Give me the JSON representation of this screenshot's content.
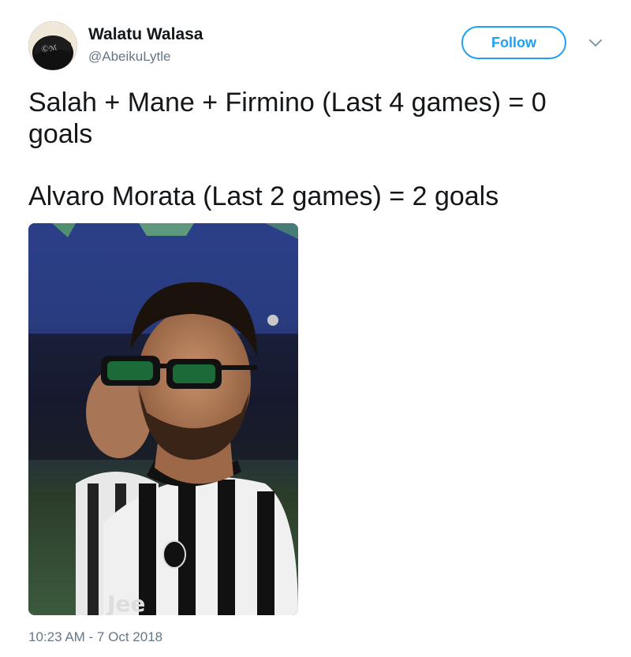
{
  "author": {
    "display_name": "Walatu Walasa",
    "handle": "@AbeikuLytle",
    "avatar_icon": "user-avatar"
  },
  "actions": {
    "follow_label": "Follow",
    "menu_icon": "chevron-down-icon"
  },
  "tweet": {
    "line1": "Salah + Mane + Firmino (Last 4 games) = 0 goals",
    "line2": "Alvaro Morata (Last 2 games) = 2 goals",
    "timestamp": "10:23 AM - 7 Oct 2018"
  },
  "colors": {
    "accent": "#1da1f2",
    "secondary_text": "#657786",
    "primary_text": "#14171a"
  }
}
